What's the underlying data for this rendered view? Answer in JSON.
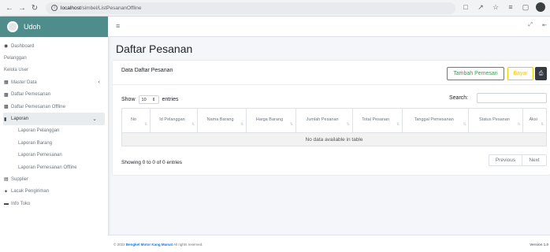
{
  "browser": {
    "url_host": "localhost",
    "url_path": "/simbel/ListPesananOffline"
  },
  "brand": {
    "name": "Udoh"
  },
  "sidebar": {
    "items": [
      {
        "label": "Dashboard",
        "icon": "dashboard-icon"
      },
      {
        "label": "Pelanggan"
      },
      {
        "label": "Kelola User"
      },
      {
        "label": "Master Data",
        "icon": "table-icon"
      },
      {
        "label": "Daftar Pemesanan",
        "icon": "cart-icon"
      },
      {
        "label": "Daftar Pemesanan Offline",
        "icon": "cart-icon"
      },
      {
        "label": "Laporan",
        "icon": "file-icon"
      }
    ],
    "laporan_sub": [
      {
        "label": "Laporan Pelanggan"
      },
      {
        "label": "Laporan Barang"
      },
      {
        "label": "Laporan Pemesanan"
      },
      {
        "label": "Laporan Pemesanan Offline"
      }
    ],
    "bottom_items": [
      {
        "label": "Supplier",
        "icon": "truck-icon"
      },
      {
        "label": "Lacak Pengiriman",
        "icon": "location-icon"
      },
      {
        "label": "Info Toko",
        "icon": "store-icon"
      }
    ]
  },
  "page": {
    "title": "Daftar Pesanan"
  },
  "card": {
    "title": "Data Daftar Pesanan",
    "buttons": {
      "tambah": "Tambah Pemesan",
      "bayar": "Bayar"
    }
  },
  "table_controls": {
    "show_prefix": "Show",
    "length_value": "10",
    "show_suffix": "entries",
    "search_label": "Search:"
  },
  "table": {
    "headers": [
      "No",
      "Id Pelanggan",
      "Nama Barang",
      "Harga Barang",
      "Jumlah Pesanan",
      "Total Pesanan",
      "Tanggal Pemesanan",
      "Status Pesanan",
      "Aksi"
    ],
    "empty_text": "No data available in table"
  },
  "pagination": {
    "info": "Showing 0 to 0 of 0 entries",
    "previous": "Previous",
    "next": "Next"
  },
  "footer": {
    "prefix": "© 2022",
    "company": "Bengkel Motor Kang Mamat",
    "suffix": "All rights reserved.",
    "version": "Version 1.0"
  },
  "colors": {
    "brand_bg": "#4e8d8c",
    "success": "#28a745",
    "warning": "#ffc107",
    "dark": "#343a40"
  }
}
